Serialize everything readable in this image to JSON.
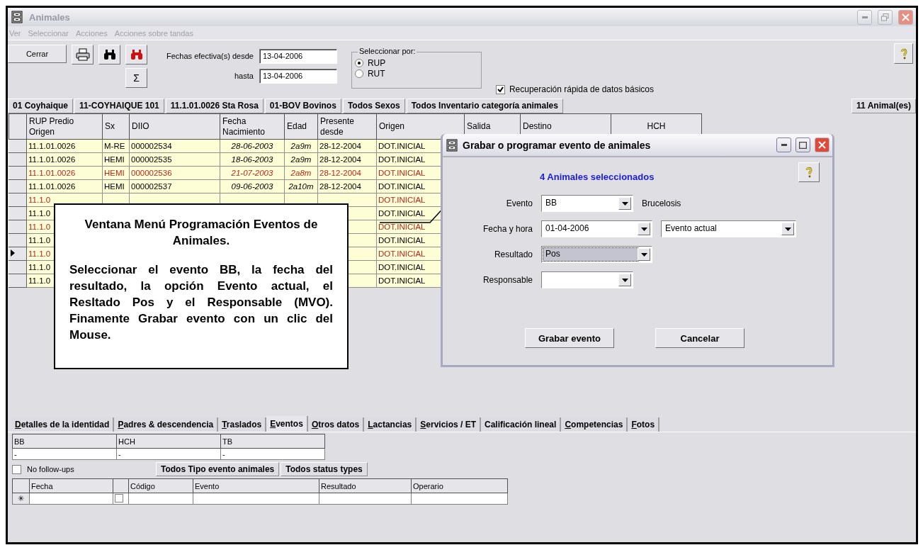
{
  "window": {
    "title": "Animales",
    "active": false
  },
  "menu": [
    {
      "label": "Ver",
      "disabled": true
    },
    {
      "label": "Seleccionar",
      "disabled": true
    },
    {
      "label": "Acciones",
      "disabled": true
    },
    {
      "label": "Acciones sobre tandas",
      "disabled": true
    }
  ],
  "toolbar": {
    "close_button": "Cerrar",
    "sum_button": "Σ",
    "date_from_label": "Fechas efectiva(s) desde",
    "date_from": "13-04-2006",
    "date_to_label": "hasta",
    "date_to": "13-04-2006",
    "select_by": {
      "legend": "Seleccionar por:",
      "options": [
        {
          "label": "RUP",
          "selected": true
        },
        {
          "label": "RUT",
          "selected": false
        }
      ]
    },
    "quick_load": {
      "label": "Recuperación rápida de datos básicos",
      "checked": true
    }
  },
  "filter_bar": {
    "items": [
      "01 Coyhaique",
      "11-COYHAIQUE 101",
      "11.1.01.0026 Sta Rosa",
      "01-BOV Bovinos",
      "Todos Sexos",
      "Todos Inventario categoría animales"
    ],
    "count": "11 Animal(es)"
  },
  "grid": {
    "columns": [
      "RUP Predio Origen",
      "Sx",
      "DIIO",
      "Fecha Nacimiento",
      "Edad",
      "Presente desde",
      "Origen",
      "Salida",
      "Destino",
      "HCH"
    ],
    "rows": [
      {
        "alert": false,
        "current": false,
        "rup": "11.1.01.0026",
        "sx": "M-RE",
        "diio": "000002534",
        "birth": "28-06-2003",
        "age": "2a9m",
        "since": "28-12-2004",
        "origin": "DOT.INICIAL"
      },
      {
        "alert": false,
        "current": false,
        "rup": "11.1.01.0026",
        "sx": "HEMI",
        "diio": "000002535",
        "birth": "18-06-2003",
        "age": "2a9m",
        "since": "28-12-2004",
        "origin": "DOT.INICIAL"
      },
      {
        "alert": true,
        "current": false,
        "rup": "11.1.01.0026",
        "sx": "HEMI",
        "diio": "000002536",
        "birth": "21-07-2003",
        "age": "2a8m",
        "since": "28-12-2004",
        "origin": "DOT.INICIAL"
      },
      {
        "alert": false,
        "current": false,
        "rup": "11.1.01.0026",
        "sx": "HEMI",
        "diio": "000002537",
        "birth": "09-06-2003",
        "age": "2a10m",
        "since": "28-12-2004",
        "origin": "DOT.INICIAL"
      },
      {
        "alert": true,
        "current": false,
        "rup": "11.1.0",
        "origin": "DOT.INICIAL"
      },
      {
        "alert": false,
        "current": false,
        "rup": "11.1.0",
        "origin": "DOT.INICIAL"
      },
      {
        "alert": true,
        "current": false,
        "rup": "11.1.0",
        "origin": "DOT.INICIAL"
      },
      {
        "alert": false,
        "current": false,
        "rup": "11.1.0",
        "origin": "DOT.INICIAL"
      },
      {
        "alert": true,
        "current": true,
        "rup": "11.1.0",
        "origin": "DOT.INICIAL"
      },
      {
        "alert": false,
        "current": false,
        "rup": "11.1.0",
        "origin": "DOT.INICIAL"
      },
      {
        "alert": false,
        "current": false,
        "rup": "11.1.0",
        "origin": "DOT.INICIAL"
      }
    ]
  },
  "callout": {
    "title": "Ventana Menú Programación Eventos de Animales.",
    "body": "Seleccionar el evento BB, la fecha del resultado, la opción Evento actual, el Resltado Pos y el Responsable (MVO). Finamente Grabar evento con un clic del Mouse."
  },
  "dialog": {
    "title": "Grabar o programar evento de animales",
    "count": "4  Animales seleccionados",
    "fields": [
      {
        "label": "Evento",
        "value": "BB",
        "note": "Brucelosis",
        "focused": false
      },
      {
        "label": "Fecha y hora",
        "value": "01-04-2006",
        "second_value": "Evento actual",
        "focused": false
      },
      {
        "label": "Resultado",
        "value": "Pos",
        "focused": true
      },
      {
        "label": "Responsable",
        "focused": false
      }
    ],
    "buttons": [
      "Grabar evento",
      "Cancelar"
    ]
  },
  "tabs": [
    {
      "label": "Detalles de la identidad",
      "selected": false,
      "hotkey": true
    },
    {
      "label": "Padres & descendencia",
      "selected": false,
      "hotkey": true
    },
    {
      "label": "Traslados",
      "selected": false,
      "hotkey": true
    },
    {
      "label": "Eventos",
      "selected": true,
      "hotkey": true
    },
    {
      "label": "Otros datos",
      "selected": false,
      "hotkey": true
    },
    {
      "label": "Lactancias",
      "selected": false,
      "hotkey": true
    },
    {
      "label": "Servicios / ET",
      "selected": false,
      "hotkey": true
    },
    {
      "label": "Calificación lineal",
      "selected": false,
      "hotkey": false
    },
    {
      "label": "Competencias",
      "selected": false,
      "hotkey": true
    },
    {
      "label": "Fotos",
      "selected": false,
      "hotkey": true
    }
  ],
  "summary": {
    "columns": [
      "BB",
      "HCH",
      "TB"
    ],
    "values": [
      "-",
      "-",
      "-"
    ]
  },
  "no_follow_ups": {
    "label": "No follow-ups",
    "checked": false
  },
  "event_filters": [
    "Todos Tipo evento animales",
    "Todos status types"
  ],
  "events_grid": {
    "columns": [
      "Fecha",
      "Código",
      "Evento",
      "Resultado",
      "Operario"
    ],
    "new_row_marker": "✳",
    "new_row_checked": false
  }
}
